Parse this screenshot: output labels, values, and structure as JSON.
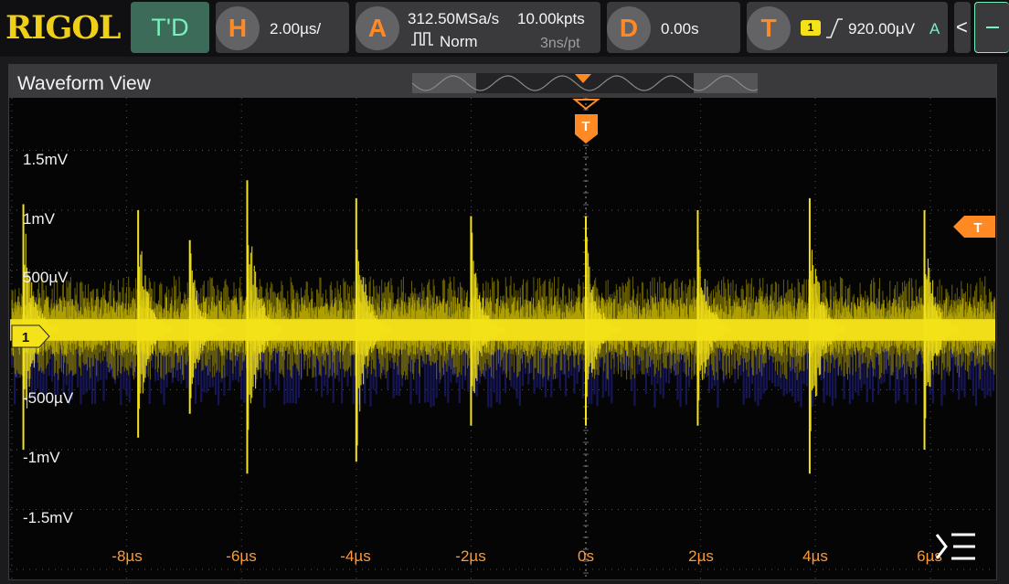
{
  "toolbar": {
    "logo": "RIGOL",
    "mode_button": "T'D",
    "horizontal": {
      "letter": "H",
      "timebase": "2.00µs/"
    },
    "acquire": {
      "letter": "A",
      "sample_rate": "312.50MSa/s",
      "memory_depth": "10.00kpts",
      "mode": "Norm",
      "time_per_point": "3ns/pt"
    },
    "delay": {
      "letter": "D",
      "value": "0.00s"
    },
    "trigger": {
      "letter": "T",
      "channel": "1",
      "level": "920.00μV",
      "sweep": "A"
    },
    "collapse_arrow": "<"
  },
  "waveform_view": {
    "title": "Waveform View",
    "trigger_marker_label": "T",
    "trigger_level_label": "T",
    "channel_marker": "1",
    "y_labels": [
      "1.5mV",
      "1mV",
      "500µV",
      "-500µV",
      "-1mV",
      "-1.5mV"
    ],
    "x_labels": [
      "-8µs",
      "-6µs",
      "-4µs",
      "-2µs",
      "0s",
      "2µs",
      "4µs",
      "6µs"
    ],
    "menu_icon": "menu-collapse-icon"
  },
  "colors": {
    "channel1": "#f4e21a",
    "trigger": "#ff8a24",
    "mode_button_bg": "#3d6b5a",
    "mode_button_text": "#79f1bc"
  },
  "chart_data": {
    "type": "line",
    "series": [
      {
        "name": "1"
      }
    ],
    "x_unit": "µs",
    "xlim": [
      -10,
      7.2
    ],
    "y_unit": "mV",
    "ylim": [
      -2.0,
      2.1
    ],
    "baseline_mV": 0,
    "noise_band_mV": [
      -0.42,
      0.45
    ],
    "spike_times_us": [
      -9.8,
      -7.8,
      -6.9,
      -5.9,
      -4.0,
      -2.0,
      0.0,
      1.95,
      3.9,
      5.9
    ],
    "spike_peak_mV": [
      1.05,
      1.0,
      0.75,
      1.25,
      1.1,
      0.95,
      0.95,
      1.0,
      1.1,
      1.0
    ],
    "spike_min_mV": [
      -1.0,
      -0.9,
      -0.7,
      -1.2,
      -1.1,
      -0.8,
      -0.8,
      -0.8,
      -1.2,
      -1.0
    ]
  }
}
